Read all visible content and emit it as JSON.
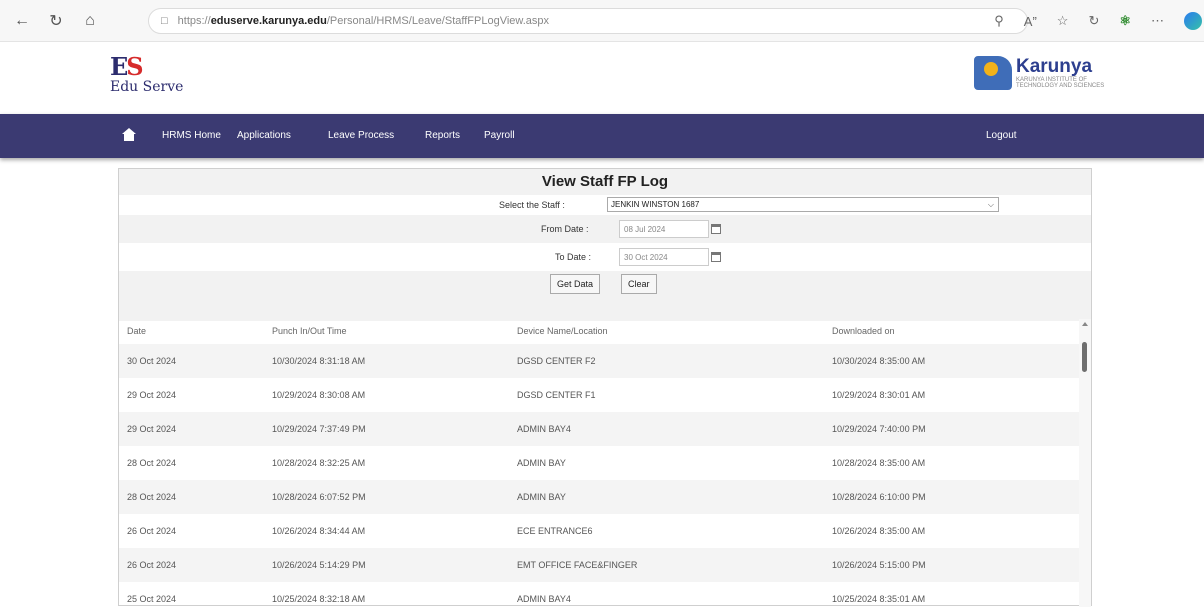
{
  "browser": {
    "url_prefix": "https://",
    "url_domain": "eduserve.karunya.edu",
    "url_path": "/Personal/HRMS/Leave/StaffFPLogView.aspx"
  },
  "header": {
    "logo_mark_e": "E",
    "logo_mark_s": "S",
    "logo_text": "Edu Serve",
    "karunya_name": "Karunya",
    "karunya_sub": "KARUNYA INSTITUTE OF TECHNOLOGY AND SCIENCES"
  },
  "nav": {
    "items": [
      "HRMS Home",
      "Applications",
      "Leave Process",
      "Reports",
      "Payroll"
    ],
    "logout": "Logout"
  },
  "page": {
    "title": "View Staff FP Log",
    "staff_label": "Select the Staff :",
    "staff_value": "JENKIN WINSTON 1687",
    "from_label": "From Date :",
    "from_value": "08 Jul 2024",
    "to_label": "To Date :",
    "to_value": "30 Oct 2024",
    "get_data": "Get Data",
    "clear": "Clear"
  },
  "table": {
    "headers": [
      "Date",
      "Punch In/Out Time",
      "Device Name/Location",
      "Downloaded on"
    ],
    "rows": [
      [
        "30 Oct 2024",
        "10/30/2024 8:31:18 AM",
        "DGSD CENTER F2",
        "10/30/2024 8:35:00 AM"
      ],
      [
        "29 Oct 2024",
        "10/29/2024 8:30:08 AM",
        "DGSD CENTER F1",
        "10/29/2024 8:30:01 AM"
      ],
      [
        "29 Oct 2024",
        "10/29/2024 7:37:49 PM",
        "ADMIN BAY4",
        "10/29/2024 7:40:00 PM"
      ],
      [
        "28 Oct 2024",
        "10/28/2024 8:32:25 AM",
        "ADMIN BAY",
        "10/28/2024 8:35:00 AM"
      ],
      [
        "28 Oct 2024",
        "10/28/2024 6:07:52 PM",
        "ADMIN BAY",
        "10/28/2024 6:10:00 PM"
      ],
      [
        "26 Oct 2024",
        "10/26/2024 8:34:44 AM",
        "ECE ENTRANCE6",
        "10/26/2024 8:35:00 AM"
      ],
      [
        "26 Oct 2024",
        "10/26/2024 5:14:29 PM",
        "EMT OFFICE FACE&FINGER",
        "10/26/2024 5:15:00 PM"
      ],
      [
        "25 Oct 2024",
        "10/25/2024 8:32:18 AM",
        "ADMIN BAY4",
        "10/25/2024 8:35:01 AM"
      ]
    ]
  }
}
